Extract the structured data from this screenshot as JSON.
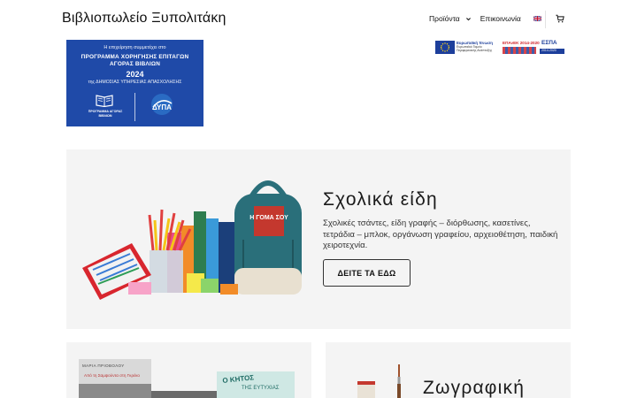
{
  "header": {
    "site_title": "Βιβλιοπωλείο Ξυπολιτάκη",
    "nav": {
      "products_label": "Προϊόντα",
      "contact_label": "Επικοινωνία",
      "language_flag": "uk-flag-icon",
      "cart_icon": "cart-icon"
    }
  },
  "program_banner": {
    "line1": "Η επιχείρηση συμμετέχει στο",
    "title1": "ΠΡΟΓΡΑΜΜΑ ΧΟΡΗΓΗΣΗΣ ΕΠΙΤΑΓΩΝ",
    "title2": "ΑΓΟΡΑΣ ΒΙΒΛΙΩΝ",
    "year": "2024",
    "line2": "της ΔΗΜΟΣΙΑΣ ΥΠΗΡΕΣΙΑΣ ΑΠΑΣΧΟΛΗΣΗΣ",
    "program_label": "ΠΡΟΓΡΑΜΜΑ ΑΓΟΡΑΣ ΒΙΒΛΙΩΝ",
    "logo_label": "ΔΥΠΑ"
  },
  "eu_strip": {
    "eu_title": "Ευρωπαϊκή Ένωση",
    "eu_sub1": "Ευρωπαϊκό Ταμείο",
    "eu_sub2": "Περιφερειακής Ανάπτυξης",
    "epanek": "ΕΠΑνΕΚ 2014-2020",
    "espa": "ΕΣΠΑ",
    "espa_years": "2014-2020"
  },
  "hero": {
    "title": "Σχολικά είδη",
    "description": "Σχολικές τσάντες, είδη γραφής – διόρθωσης, κασετίνες, τετράδια – μπλοκ, οργάνωση γραφείου, αρχειοθέτηση, παιδική χειροτεχνία.",
    "button_label": "ΔΕΙΤΕ ΤΑ ΕΔΩ",
    "bag_label": "Η ΓΟΜΑ ΣΟΥ"
  },
  "cards": {
    "books": {
      "book1_author": "ΜΑΡΙΑ ΠΡΙΟΒΟΛΟΥ",
      "book1_title": "Από τη Σαμψούντα στη Γκρέκο",
      "book2_title": "Ο ΚΗΤΟΣ",
      "book2_sub": "ΤΗΣ ΕΥΤΥΧΙΑΣ"
    },
    "painting": {
      "title": "Ζωγραφική"
    }
  },
  "colors": {
    "banner_blue": "#1f4aa8",
    "section_bg": "#f4f4f4",
    "bag_teal": "#2a6f7a",
    "accent_red": "#c4382e"
  }
}
